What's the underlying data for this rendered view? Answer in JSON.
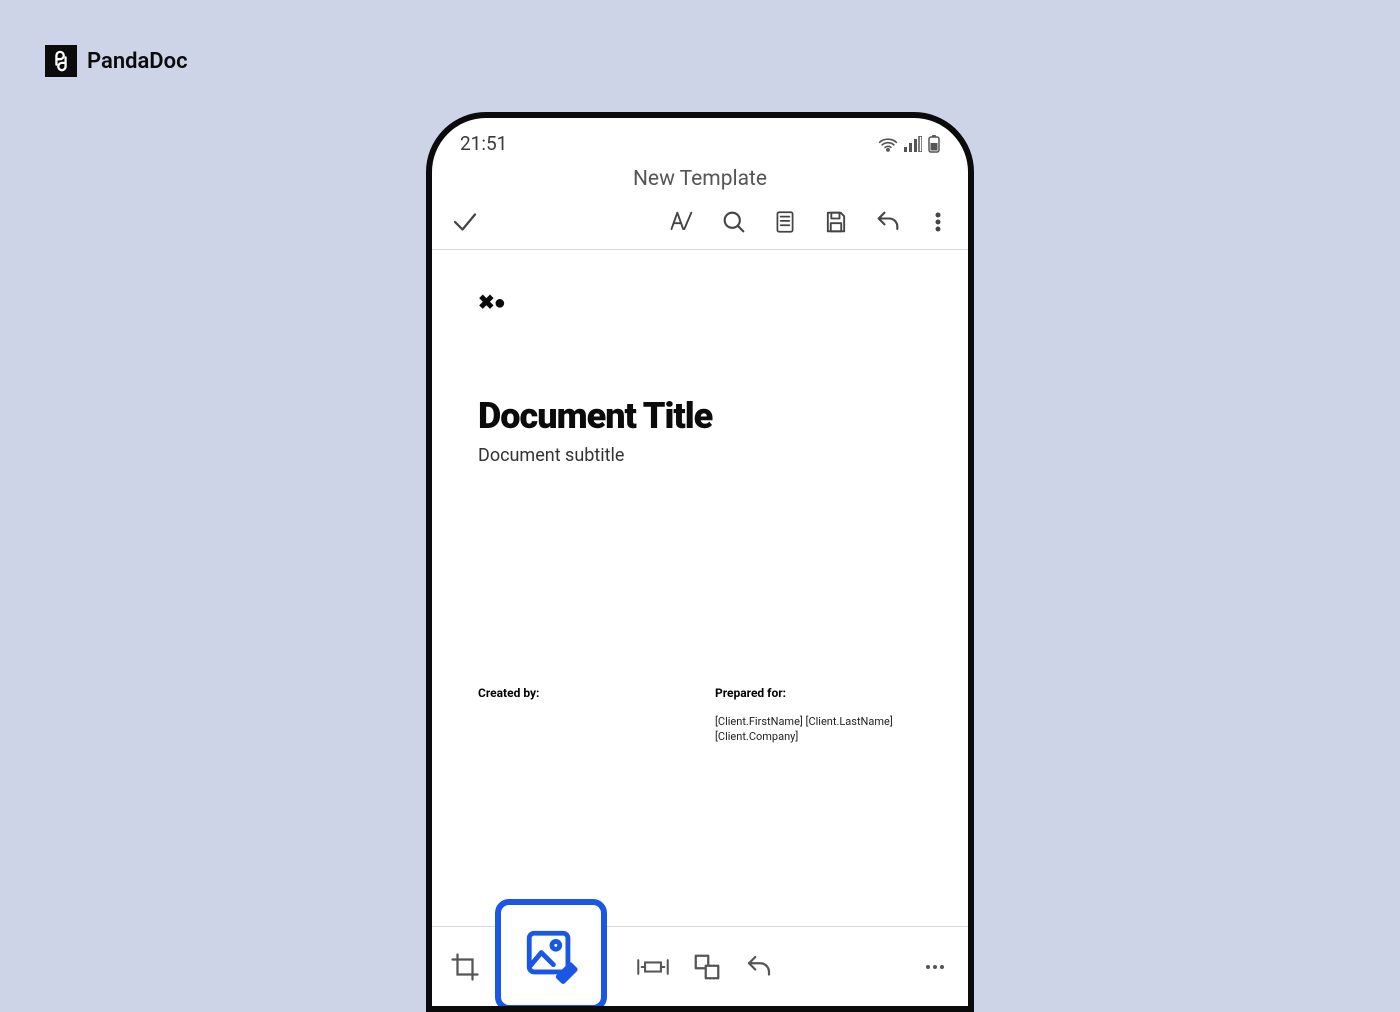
{
  "brand": {
    "name": "PandaDoc"
  },
  "status": {
    "time": "21:51"
  },
  "header": {
    "title": "New Template"
  },
  "doc": {
    "title": "Document Title",
    "subtitle": "Document subtitle",
    "created_by_label": "Created by:",
    "prepared_for_label": "Prepared for:",
    "client_name_line": "[Client.FirstName] [Client.LastName]",
    "client_company_line": "[Client.Company]"
  },
  "icons": {
    "top": [
      "check",
      "text-style",
      "search",
      "reader",
      "save",
      "undo",
      "more-vertical"
    ],
    "bottom": [
      "crop",
      "image-edit",
      "ruler",
      "shapes",
      "undo",
      "more-horizontal"
    ]
  }
}
